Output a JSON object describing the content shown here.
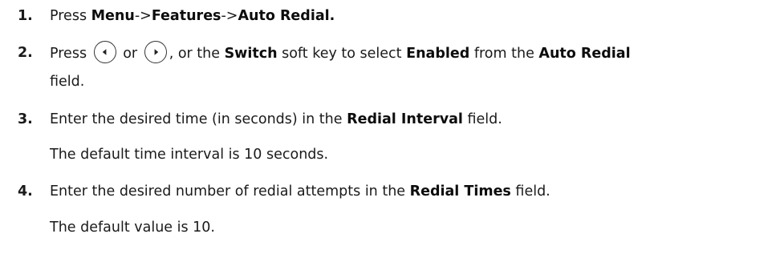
{
  "steps": [
    {
      "number": "1.",
      "parts": [
        "Press ",
        "Menu",
        "->",
        "Features",
        "->",
        "Auto Redial."
      ]
    },
    {
      "number": "2.",
      "parts": [
        "Press",
        "or",
        ", or the ",
        "Switch",
        " soft key to select ",
        "Enabled",
        " from the ",
        "Auto Redial"
      ],
      "continuation": "field.",
      "buttons": [
        "left-arrow",
        "right-arrow"
      ]
    },
    {
      "number": "3.",
      "parts": [
        "Enter the desired time (in seconds) in the ",
        "Redial Interval",
        " field."
      ],
      "note": "The default time interval is 10 seconds."
    },
    {
      "number": "4.",
      "parts": [
        "Enter the desired number of redial attempts in the ",
        "Redial Times",
        " field."
      ],
      "note": "The default value is 10."
    }
  ]
}
